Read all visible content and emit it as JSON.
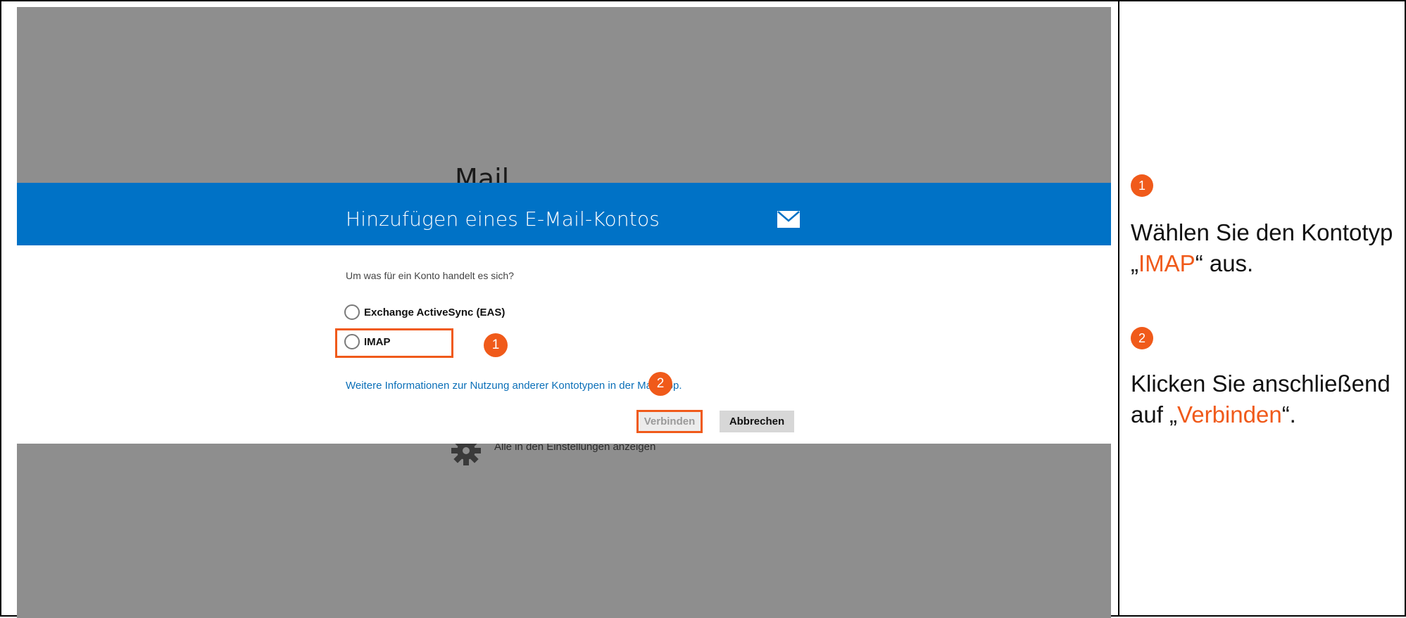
{
  "background_app": {
    "title": "Mail",
    "settings_text": "Alle in den Einstellungen anzeigen"
  },
  "dialog": {
    "title": "Hinzufügen eines E-Mail-Kontos",
    "question": "Um was für ein Konto handelt es sich?",
    "options": [
      {
        "label": "Exchange ActiveSync (EAS)"
      },
      {
        "label": "IMAP"
      }
    ],
    "info_link": "Weitere Informationen zur Nutzung anderer Kontotypen in der Mail-App.",
    "connect_label": "Verbinden",
    "cancel_label": "Abbrechen"
  },
  "annotations": {
    "badge_1": "1",
    "badge_2": "2",
    "accent_color": "#f05a1a"
  },
  "instructions": {
    "step1_badge": "1",
    "step1_prefix": "Wählen Sie den Kontotyp „",
    "step1_highlight": "IMAP",
    "step1_suffix": "“ aus.",
    "step2_badge": "2",
    "step2_prefix": "Klicken Sie anschließend auf „",
    "step2_highlight": "Verbinden",
    "step2_suffix": "“."
  },
  "colors": {
    "header_blue": "#0072c6",
    "overlay_gray": "#8e8e8e",
    "link_blue": "#0b6fb8"
  }
}
